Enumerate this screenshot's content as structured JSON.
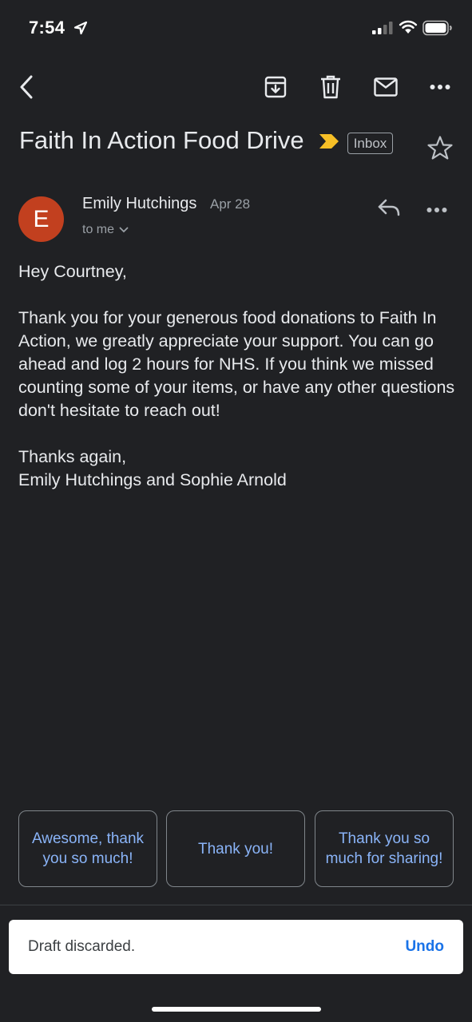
{
  "status_bar": {
    "time": "7:54"
  },
  "toolbar": {
    "icons": [
      "back-arrow-icon",
      "archive-icon",
      "trash-icon",
      "mail-icon",
      "more-vert-icon"
    ]
  },
  "email": {
    "subject": "Faith In Action Food Drive",
    "label": "Inbox",
    "importance_color": "#f6bf26",
    "sender": {
      "initial": "E",
      "avatar_color": "#c2401f",
      "name": "Emily Hutchings",
      "date": "Apr 28",
      "recipient": "to me"
    },
    "body": [
      "Hey Courtney,",
      "Thank you for your generous food donations to Faith In Action, we greatly appreciate your support. You can go ahead and log 2 hours for NHS. If you think we missed counting some of your items, or have any other questions don't hesitate to reach out!",
      "Thanks again,"
    ],
    "signature": "Emily Hutchings and Sophie Arnold"
  },
  "smart_replies": [
    "Awesome, thank you so much!",
    "Thank you!",
    "Thank you so much for sharing!"
  ],
  "snackbar": {
    "message": "Draft discarded.",
    "action": "Undo"
  },
  "colors": {
    "background": "#202124",
    "link": "#8ab4f8",
    "snackbar_action": "#1a73e8"
  }
}
